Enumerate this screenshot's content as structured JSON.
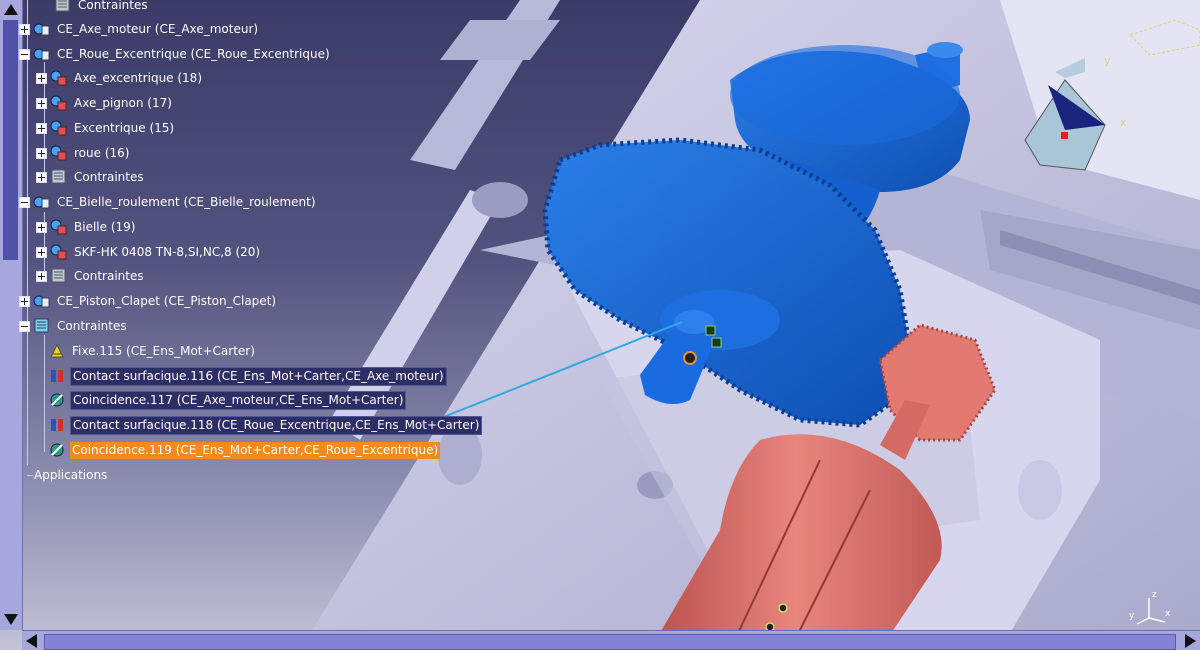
{
  "tree": {
    "nodes": [
      {
        "label": "Contraintes",
        "icon": "constraints-folder-icon",
        "expander": "none"
      },
      {
        "label": "CE_Axe_moteur (CE_Axe_moteur)",
        "icon": "product-icon",
        "expander": "plus"
      },
      {
        "label": "CE_Roue_Excentrique (CE_Roue_Excentrique)",
        "icon": "product-icon",
        "expander": "minus"
      },
      {
        "label": "Axe_excentrique (18)",
        "icon": "part-icon",
        "expander": "plus"
      },
      {
        "label": "Axe_pignon (17)",
        "icon": "part-icon",
        "expander": "plus"
      },
      {
        "label": "Excentrique (15)",
        "icon": "part-icon",
        "expander": "plus"
      },
      {
        "label": "roue (16)",
        "icon": "part-icon",
        "expander": "plus"
      },
      {
        "label": "Contraintes",
        "icon": "constraints-folder-icon",
        "expander": "plus"
      },
      {
        "label": "CE_Bielle_roulement (CE_Bielle_roulement)",
        "icon": "product-icon",
        "expander": "minus"
      },
      {
        "label": "Bielle (19)",
        "icon": "part-icon",
        "expander": "plus"
      },
      {
        "label": "SKF-HK 0408 TN-8,SI,NC,8 (20)",
        "icon": "part-icon",
        "expander": "plus"
      },
      {
        "label": "Contraintes",
        "icon": "constraints-folder-icon",
        "expander": "plus"
      },
      {
        "label": "CE_Piston_Clapet (CE_Piston_Clapet)",
        "icon": "product-icon",
        "expander": "plus"
      },
      {
        "label": "Contraintes",
        "icon": "constraints-folder-icon",
        "expander": "minus"
      },
      {
        "label": "Fixe.115 (CE_Ens_Mot+Carter)",
        "icon": "fix-constraint-icon",
        "expander": "none"
      },
      {
        "label": "Contact surfacique.116 (CE_Ens_Mot+Carter,CE_Axe_moteur)",
        "icon": "contact-constraint-icon",
        "expander": "none"
      },
      {
        "label": "Coincidence.117 (CE_Axe_moteur,CE_Ens_Mot+Carter)",
        "icon": "coincidence-constraint-icon",
        "expander": "none"
      },
      {
        "label": "Contact surfacique.118 (CE_Roue_Excentrique,CE_Ens_Mot+Carter)",
        "icon": "contact-constraint-icon",
        "expander": "none"
      },
      {
        "label": "Coincidence.119 (CE_Ens_Mot+Carter,CE_Roue_Excentrique)",
        "icon": "coincidence-constraint-icon",
        "expander": "none",
        "selected": true
      }
    ],
    "applications_label": "Applications"
  },
  "compass": {
    "x": "x",
    "y": "y",
    "z": "z"
  },
  "colors": {
    "background_top": "#3c3b68",
    "background_bottom": "#c3c3d8",
    "gear_blue": "#1565d8",
    "motor_red": "#e0726a",
    "carter": "#c9c9e6",
    "selection": "#f28a1c",
    "scrollbar": "#a7a7dd",
    "leader_line": "#30a8e0"
  }
}
